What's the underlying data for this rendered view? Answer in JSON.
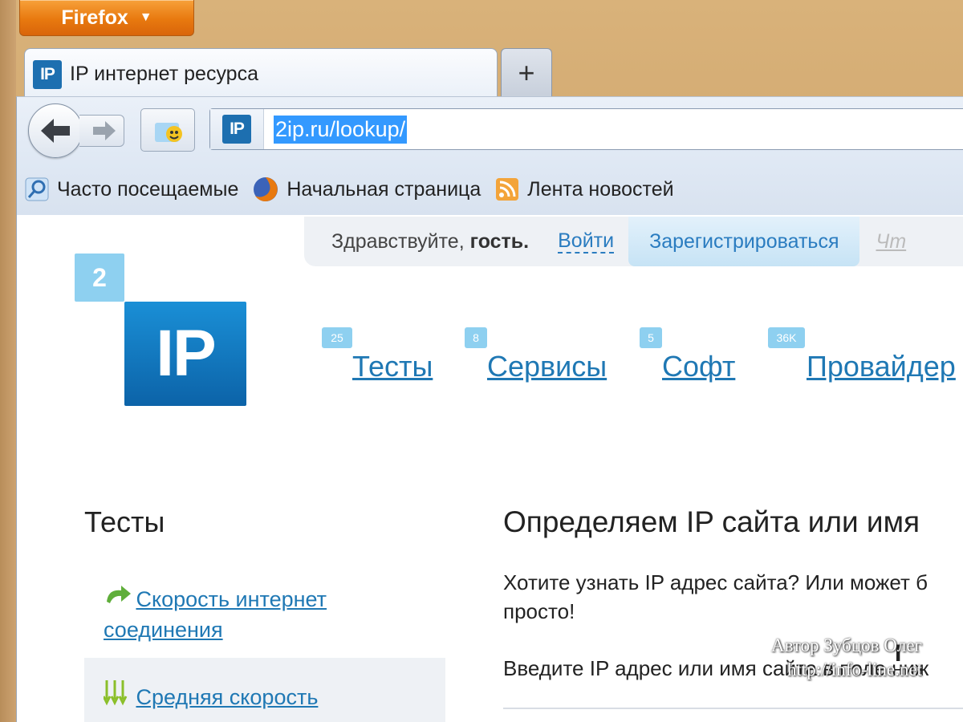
{
  "browser": {
    "menu_button": "Firefox",
    "tab_title": "IP интернет ресурса",
    "new_tab": "+",
    "url": "2ip.ru/lookup/",
    "favicon_text": "IP",
    "bookmarks": [
      "Часто посещаемые",
      "Начальная страница",
      "Лента новостей"
    ]
  },
  "site": {
    "greeting": "Здравствуйте,",
    "guest": "гость.",
    "login": "Войти",
    "register": "Зарегистрироваться",
    "more": "Чт",
    "logo_small": "2",
    "logo_big": "IP",
    "nav": [
      {
        "badge": "25",
        "label": "Тесты"
      },
      {
        "badge": "8",
        "label": "Сервисы"
      },
      {
        "badge": "5",
        "label": "Софт"
      },
      {
        "badge": "36K",
        "label": "Провайдер"
      }
    ],
    "left_heading": "Тесты",
    "left_links": [
      "Скорость интернет соединения",
      "Средняя скорость"
    ],
    "right_heading": "Определяем IP сайта или имя",
    "right_p1_line1": "Хотите узнать IP адрес сайта? Или может б",
    "right_p1_line2": "просто!",
    "right_p2": "Введите IP адрес или имя сайта в поле ниж"
  },
  "overlay": {
    "watermark_line1": "Автор Зубцов Олег",
    "watermark_line2": "http://info-line.net"
  },
  "colors": {
    "accent": "#1f78b4",
    "firefox_orange": "#e8790f",
    "logo_blue": "#0c63a8"
  }
}
